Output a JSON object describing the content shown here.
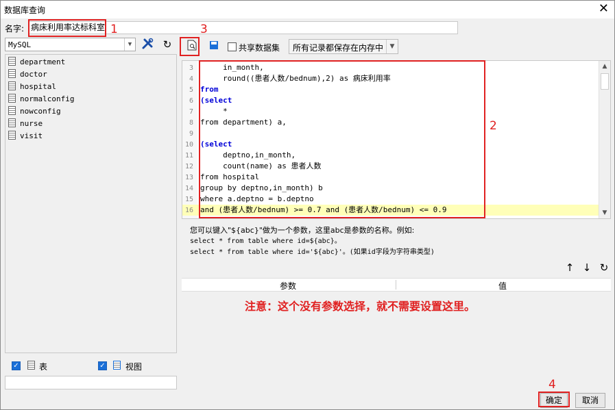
{
  "window": {
    "title": "数据库查询",
    "close_glyph": "✕"
  },
  "name_row": {
    "label": "名字:",
    "value": "病床利用率达标科室"
  },
  "annotations": {
    "n1": "1",
    "n2": "2",
    "n3": "3",
    "n4": "4",
    "color": "#e02020"
  },
  "left": {
    "db_type": "MySQL",
    "tables": [
      "department",
      "doctor",
      "hospital",
      "normalconfig",
      "nowconfig",
      "nurse",
      "visit"
    ],
    "show_tables_label": "表",
    "show_views_label": "视图",
    "show_tables_checked": true,
    "show_views_checked": true
  },
  "toolbar": {
    "shared_dataset_label": "共享数据集",
    "shared_dataset_checked": false,
    "cache_mode": "所有记录都保存在内存中"
  },
  "editor": {
    "highlight_line": 16,
    "lines": [
      {
        "n": "3",
        "text": "     in_month,"
      },
      {
        "n": "4",
        "text": "     round((患者人数/bednum),2) as 病床利用率"
      },
      {
        "n": "5",
        "text": "from"
      },
      {
        "n": "6",
        "text": "(select"
      },
      {
        "n": "7",
        "text": "     *"
      },
      {
        "n": "8",
        "text": "from department) a,"
      },
      {
        "n": "9",
        "text": ""
      },
      {
        "n": "10",
        "text": "(select"
      },
      {
        "n": "11",
        "text": "     deptno,in_month,"
      },
      {
        "n": "12",
        "text": "     count(name) as 患者人数"
      },
      {
        "n": "13",
        "text": "from hospital"
      },
      {
        "n": "14",
        "text": "group by deptno,in_month) b"
      },
      {
        "n": "15",
        "text": "where a.deptno = b.deptno"
      },
      {
        "n": "16",
        "text": "and (患者人数/bednum) >= 0.7 and (患者人数/bednum) <= 0.9"
      }
    ]
  },
  "hint": {
    "line1": "您可以键入\"${abc}\"做为一个参数，这里abc是参数的名称。例如:",
    "line2": "select * from table where id=${abc}。",
    "line3": "select * from table where id='${abc}'。(如果id字段为字符串类型)"
  },
  "params": {
    "col_param": "参数",
    "col_value": "值",
    "notice": "注意：这个没有参数选择，就不需要设置这里。"
  },
  "footer": {
    "ok_label": "确定",
    "cancel_label": "取消"
  }
}
